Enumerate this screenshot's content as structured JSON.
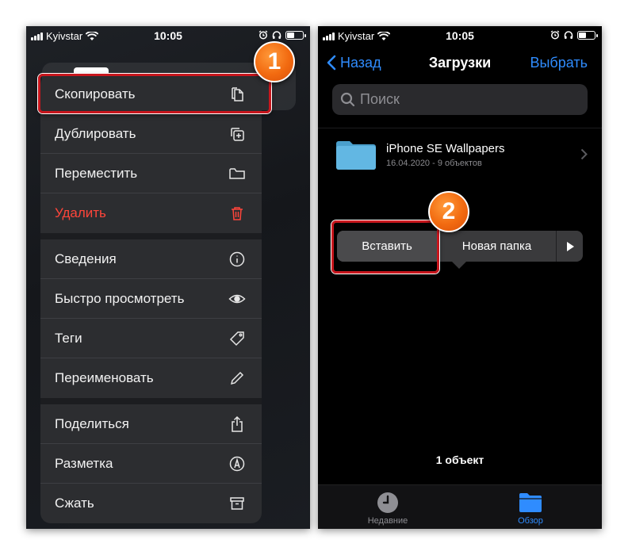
{
  "left_phone": {
    "status": {
      "carrier": "Kyivstar",
      "time": "10:05"
    },
    "menu": {
      "items": [
        {
          "label": "Скопировать",
          "icon": "copy-icon"
        },
        {
          "label": "Дублировать",
          "icon": "duplicate-icon"
        },
        {
          "label": "Переместить",
          "icon": "folder-icon"
        },
        {
          "label": "Удалить",
          "icon": "trash-icon",
          "color": "#ff453a"
        },
        {
          "label": "Сведения",
          "icon": "info-icon"
        },
        {
          "label": "Быстро просмотреть",
          "icon": "eye-icon"
        },
        {
          "label": "Теги",
          "icon": "tag-icon"
        },
        {
          "label": "Переименовать",
          "icon": "pencil-icon"
        },
        {
          "label": "Поделиться",
          "icon": "share-icon"
        },
        {
          "label": "Разметка",
          "icon": "markup-icon"
        },
        {
          "label": "Сжать",
          "icon": "archive-icon"
        }
      ]
    },
    "step_badge": "1"
  },
  "right_phone": {
    "status": {
      "carrier": "Kyivstar",
      "time": "10:05"
    },
    "nav": {
      "back_label": "Назад",
      "title": "Загрузки",
      "select_label": "Выбрать"
    },
    "search": {
      "placeholder": "Поиск"
    },
    "folder": {
      "name": "iPhone SE Wallpapers",
      "meta": "16.04.2020 - 9 объектов"
    },
    "context_menu": {
      "paste": "Вставить",
      "new_folder": "Новая папка"
    },
    "item_count": "1 объект",
    "tabs": {
      "recent": "Недавние",
      "browse": "Обзор"
    },
    "step_badge": "2"
  },
  "colors": {
    "accent_blue": "#2f8cff",
    "destructive_red": "#ff453a",
    "callout_red": "#c8161d",
    "badge_orange": "#f26a10",
    "folder_blue": "#5ab4e0"
  }
}
